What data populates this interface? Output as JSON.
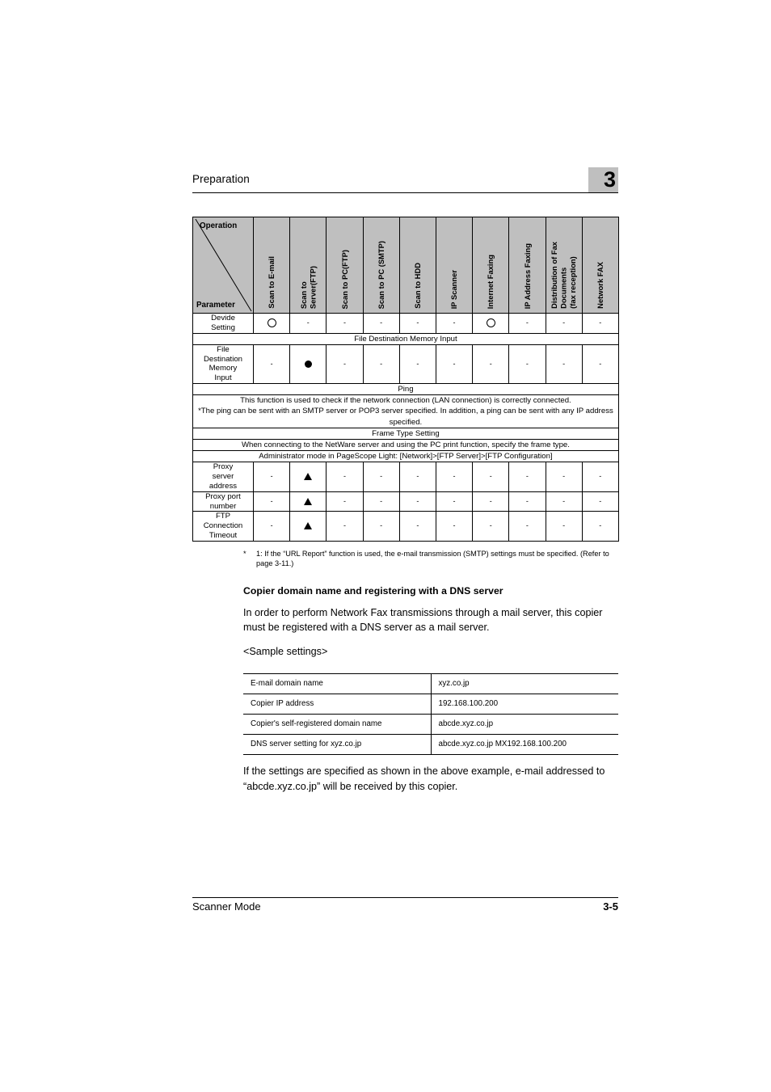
{
  "header": {
    "running_title": "Preparation",
    "chapter_number": "3"
  },
  "matrix_table": {
    "corner": {
      "operation_label": "Operation",
      "parameter_label": "Parameter"
    },
    "operation_columns": [
      "Scan to E-mail",
      "Scan to\nServer(FTP)",
      "Scan to PC(FTP)",
      "Scan to PC (SMTP)",
      "Scan to HDD",
      "IP Scanner",
      "Internet Faxing",
      "IP Address Faxing",
      "Distribution of Fax\nDocuments\n(fax reception)",
      "Network FAX"
    ],
    "rows": [
      {
        "kind": "data",
        "parameter": "Devide\nSetting",
        "values": [
          "circle",
          "dash",
          "dash",
          "dash",
          "dash",
          "dash",
          "circle",
          "dash",
          "dash",
          "dash"
        ]
      },
      {
        "kind": "span",
        "text": "File Destination Memory Input"
      },
      {
        "kind": "data",
        "parameter": "File\nDestination\nMemory\nInput",
        "values": [
          "dash",
          "filled",
          "dash",
          "dash",
          "dash",
          "dash",
          "dash",
          "dash",
          "dash",
          "dash"
        ]
      },
      {
        "kind": "span",
        "text": "Ping"
      },
      {
        "kind": "span",
        "text": "This function is used to check if the network connection (LAN connection) is correctly connected.\n*The ping can be sent with an SMTP server or POP3 server specified. In addition, a ping can be sent with any IP address specified."
      },
      {
        "kind": "span",
        "text": "Frame Type Setting"
      },
      {
        "kind": "span",
        "text": "When connecting to the NetWare server and using the PC print function, specify the frame type."
      },
      {
        "kind": "span",
        "text": "Administrator mode in PageScope Light: [Network]>[FTP Server]>[FTP Configuration]"
      },
      {
        "kind": "data",
        "parameter": "Proxy\nserver\naddress",
        "values": [
          "dash",
          "triangle",
          "dash",
          "dash",
          "dash",
          "dash",
          "dash",
          "dash",
          "dash",
          "dash"
        ]
      },
      {
        "kind": "data",
        "parameter": "Proxy port\nnumber",
        "values": [
          "dash",
          "triangle",
          "dash",
          "dash",
          "dash",
          "dash",
          "dash",
          "dash",
          "dash",
          "dash"
        ]
      },
      {
        "kind": "data",
        "parameter": "FTP\nConnection\nTimeout",
        "values": [
          "dash",
          "triangle",
          "dash",
          "dash",
          "dash",
          "dash",
          "dash",
          "dash",
          "dash",
          "dash"
        ]
      }
    ]
  },
  "footnote": {
    "marker": "*",
    "text": "1: If the “URL Report” function is used, the e-mail transmission (SMTP) settings must be specified. (Refer to page 3-11.)"
  },
  "section": {
    "heading": "Copier domain name and registering with a DNS server",
    "intro_paragraph": "In order to perform Network Fax transmissions through a mail server, this copier must be registered with a DNS server as a mail server.",
    "sample_label": "<Sample settings>",
    "closing_paragraph": "If the settings are specified as shown in the above example, e-mail addressed to “abcde.xyz.co.jp” will be received by this copier."
  },
  "sample_settings": {
    "rows": [
      {
        "label": "E-mail domain name",
        "value": "xyz.co.jp"
      },
      {
        "label": "Copier IP address",
        "value": "192.168.100.200"
      },
      {
        "label": "Copier's self-registered domain name",
        "value": "abcde.xyz.co.jp"
      },
      {
        "label": "DNS server setting for xyz.co.jp",
        "value": "abcde.xyz.co.jp MX192.168.100.200"
      }
    ]
  },
  "footer": {
    "left": "Scanner Mode",
    "right": "3-5"
  }
}
